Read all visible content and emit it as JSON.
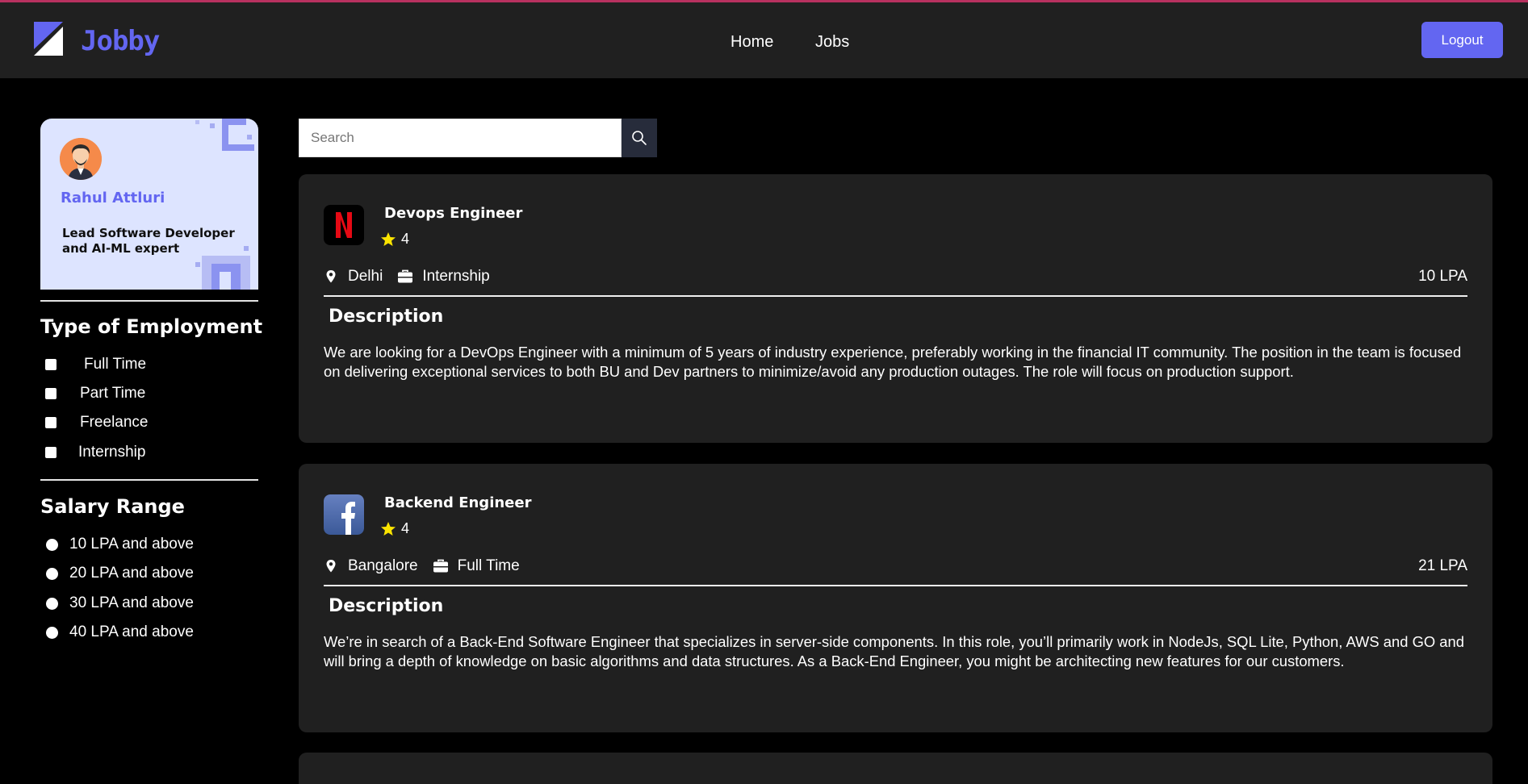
{
  "header": {
    "brand": "Jobby",
    "nav": {
      "home": "Home",
      "jobs": "Jobs"
    },
    "logout_label": "Logout",
    "accent_color": "#6366f1"
  },
  "profile": {
    "name": "Rahul Attluri",
    "bio": "Lead Software Developer and AI-ML expert"
  },
  "filters": {
    "employment_title": "Type of Employment",
    "employment_types": [
      "Full Time",
      "Part Time",
      "Freelance",
      "Internship"
    ],
    "salary_title": "Salary Range",
    "salary_ranges": [
      "10 LPA and above",
      "20 LPA and above",
      "30 LPA and above",
      "40 LPA and above"
    ]
  },
  "search": {
    "placeholder": "Search",
    "value": ""
  },
  "jobs": [
    {
      "company_icon": "netflix-logo",
      "title": "Devops Engineer",
      "rating": "4",
      "location": "Delhi",
      "employment_type": "Internship",
      "package": "10 LPA",
      "description_heading": "Description",
      "description": "We are looking for a DevOps Engineer with a minimum of 5 years of industry experience, preferably working in the financial IT community. The position in the team is focused on delivering exceptional services to both BU and Dev partners to minimize/avoid any production outages. The role will focus on production support."
    },
    {
      "company_icon": "facebook-logo",
      "title": "Backend Engineer",
      "rating": "4",
      "location": "Bangalore",
      "employment_type": "Full Time",
      "package": "21 LPA",
      "description_heading": "Description",
      "description": "We’re in search of a Back-End Software Engineer that specializes in server-side components. In this role, you’ll primarily work in NodeJs, SQL Lite, Python, AWS and GO and will bring a depth of knowledge on basic algorithms and data structures. As a Back-End Engineer, you might be architecting new features for our customers."
    }
  ]
}
